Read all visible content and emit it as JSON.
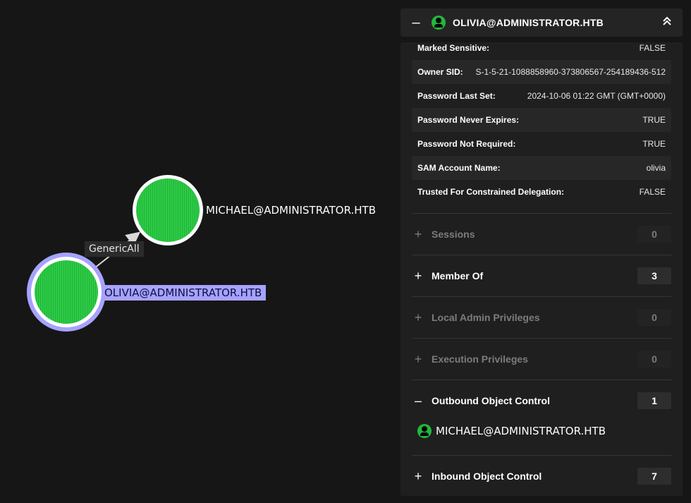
{
  "graph": {
    "nodes": [
      {
        "id": "michael",
        "label": "MICHAEL@ADMINISTRATOR.HTB",
        "selected": false
      },
      {
        "id": "olivia",
        "label": "OLIVIA@ADMINISTRATOR.HTB",
        "selected": true
      }
    ],
    "edge": {
      "label": "GenericAll"
    },
    "colors": {
      "node_fill": "#2bcc45",
      "selected_ring": "#a6a3ff",
      "background": "#161616"
    }
  },
  "panel": {
    "header": {
      "collapse": "–",
      "title": "OLIVIA@ADMINISTRATOR.HTB",
      "icon": "user-icon",
      "expand_icon": "double-chevron-up-icon"
    },
    "properties": [
      {
        "key": "Marked Sensitive:",
        "value": "FALSE"
      },
      {
        "key": "Owner SID:",
        "value": "S-1-5-21-1088858960-373806567-254189436-512"
      },
      {
        "key": "Password Last Set:",
        "value": "2024-10-06 01:22 GMT (GMT+0000)"
      },
      {
        "key": "Password Never Expires:",
        "value": "TRUE"
      },
      {
        "key": "Password Not Required:",
        "value": "TRUE"
      },
      {
        "key": "SAM Account Name:",
        "value": "olivia"
      },
      {
        "key": "Trusted For Constrained Delegation:",
        "value": "FALSE"
      }
    ],
    "sections": [
      {
        "sign": "+",
        "label": "Sessions",
        "count": "0"
      },
      {
        "sign": "+",
        "label": "Member Of",
        "count": "3"
      },
      {
        "sign": "+",
        "label": "Local Admin Privileges",
        "count": "0"
      },
      {
        "sign": "+",
        "label": "Execution Privileges",
        "count": "0"
      },
      {
        "sign": "–",
        "label": "Outbound Object Control",
        "count": "1"
      },
      {
        "sign": "+",
        "label": "Inbound Object Control",
        "count": "7"
      }
    ],
    "outbound_item": {
      "label": "MICHAEL@ADMINISTRATOR.HTB"
    }
  }
}
